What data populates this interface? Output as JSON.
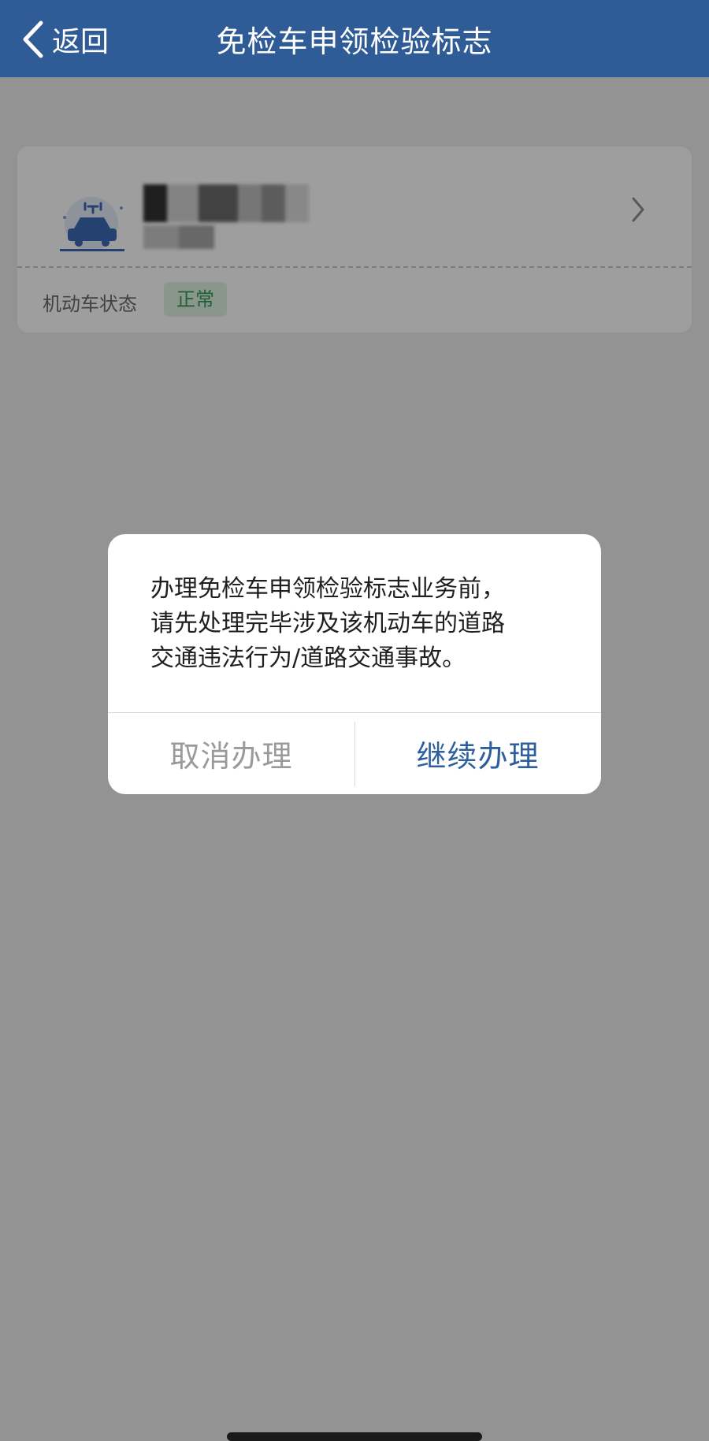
{
  "navbar": {
    "back_label": "返回",
    "title": "免检车申领检验标志"
  },
  "vehicle_card": {
    "icon": "electric-car-icon",
    "status_label": "机动车状态",
    "status_value": "正常"
  },
  "dialog": {
    "message_lines": [
      "办理免检车申领检验标志业务前，",
      "请先处理完毕涉及该机动车的道路",
      "交通违法行为/道路交通事故。"
    ],
    "cancel_label": "取消办理",
    "confirm_label": "继续办理"
  },
  "colors": {
    "navbar_bg": "#2f5c96",
    "confirm_text": "#2d5f9e",
    "cancel_text": "#9a9a9a",
    "badge_bg": "#dff1e3",
    "badge_text": "#2f9d56"
  }
}
